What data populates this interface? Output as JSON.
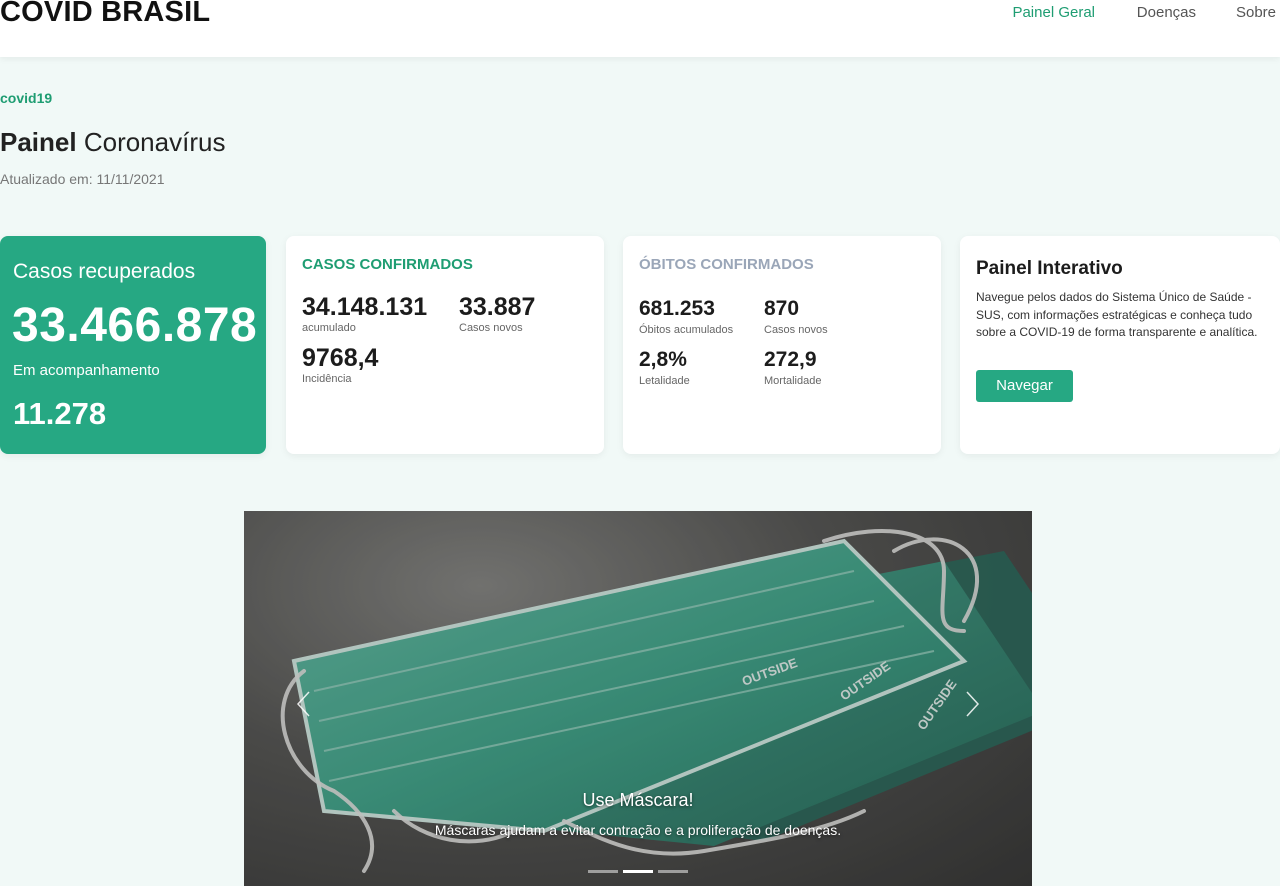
{
  "brand": "COVID BRASIL",
  "nav": {
    "links": [
      {
        "label": "Painel Geral",
        "active": true
      },
      {
        "label": "Doenças",
        "active": false
      },
      {
        "label": "Sobre",
        "active": false
      }
    ]
  },
  "header": {
    "tag": "covid19",
    "title_bold": "Painel",
    "title_rest": "Coronavírus",
    "updated": "Atualizado em: 11/11/2021"
  },
  "recovered": {
    "label": "Casos recuperados",
    "value": "33.466.878",
    "sub_label": "Em acompanhamento",
    "sub_value": "11.278"
  },
  "cases": {
    "heading": "CASOS CONFIRMADOS",
    "accumulated_value": "34.148.131",
    "accumulated_label": "acumulado",
    "new_value": "33.887",
    "new_label": "Casos novos",
    "incidence_value": "9768,4",
    "incidence_label": "Incidência"
  },
  "deaths": {
    "heading": "ÓBITOS CONFIRMADOS",
    "accumulated_value": "681.253",
    "accumulated_label": "Óbitos acumulados",
    "new_value": "870",
    "new_label": "Casos novos",
    "lethality_value": "2,8%",
    "lethality_label": "Letalidade",
    "mortality_value": "272,9",
    "mortality_label": "Mortalidade"
  },
  "panel": {
    "title": "Painel Interativo",
    "text": "Navegue pelos dados do Sistema Único de Saúde - SUS, com informações estratégicas e conheça tudo sobre a COVID-19 de forma transparente e analítica.",
    "button": "Navegar"
  },
  "carousel": {
    "caption_title": "Use Máscara!",
    "caption_text": "Máscaras ajudam a evitar contração e a proliferação de doenças.",
    "mask_print": "OUTSIDE",
    "slide_count": 3,
    "active_slide": 2
  },
  "colors": {
    "accent": "#26a883",
    "accent_text": "#1e9d72",
    "background": "#f1f9f7",
    "muted_heading": "#9aa6b8",
    "mask": "#4cae96"
  }
}
